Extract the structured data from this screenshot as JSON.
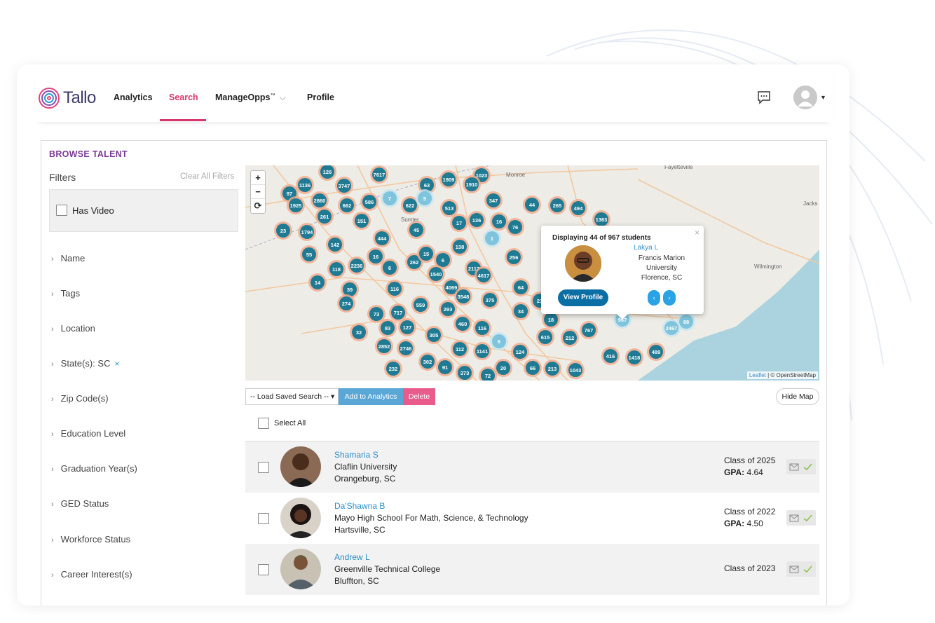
{
  "app": {
    "logo_text": "Tallo"
  },
  "nav": {
    "items": [
      {
        "label": "Analytics"
      },
      {
        "label": "Search"
      },
      {
        "label": "ManageOpps"
      },
      {
        "label": "Profile"
      }
    ],
    "trademark": "™",
    "active": "Search"
  },
  "browse": {
    "title": "BROWSE TALENT",
    "filters_label": "Filters",
    "clear_all": "Clear All Filters",
    "has_video": "Has Video",
    "filters": [
      {
        "label": "Name"
      },
      {
        "label": "Tags"
      },
      {
        "label": "Location"
      },
      {
        "label": "State(s): SC"
      },
      {
        "label": "Zip Code(s)"
      },
      {
        "label": "Education Level"
      },
      {
        "label": "Graduation Year(s)"
      },
      {
        "label": "GED Status"
      },
      {
        "label": "Workforce Status"
      },
      {
        "label": "Career Interest(s)"
      }
    ]
  },
  "map": {
    "zoom_in": "+",
    "zoom_out": "−",
    "reset": "⟳",
    "attribution_leaflet": "Leaflet",
    "attribution_rest": " | © OpenStreetMap",
    "place_labels": [
      "Monroe",
      "Fayetteville",
      "Wilmington",
      "Sumter",
      "Jacks"
    ],
    "clusters": [
      "126",
      "7617",
      "1136",
      "3747",
      "97",
      "2860",
      "1925",
      "662",
      "586",
      "622",
      "513",
      "1909",
      "63",
      "1023",
      "1910",
      "347",
      "44",
      "265",
      "494",
      "1363",
      "261",
      "151",
      "23",
      "1794",
      "45",
      "17",
      "136",
      "16",
      "76",
      "444",
      "142",
      "55",
      "16",
      "6",
      "262",
      "15",
      "6",
      "138",
      "256",
      "118",
      "2236",
      "1540",
      "2117",
      "4617",
      "14",
      "39",
      "116",
      "4069",
      "3548",
      "375",
      "64",
      "274",
      "559",
      "293",
      "21",
      "73",
      "717",
      "34",
      "18",
      "83",
      "127",
      "460",
      "116",
      "32",
      "305",
      "615",
      "212",
      "767",
      "2852",
      "2746",
      "112",
      "1141",
      "6",
      "124",
      "416",
      "1418",
      "489",
      "232",
      "302",
      "91",
      "373",
      "20",
      "66",
      "213",
      "1043",
      "72",
      "88",
      "2467",
      "967",
      "7",
      "5",
      "1"
    ],
    "popup": {
      "header": "Displaying 44 of 967 students",
      "name": "Lakya L",
      "school": "Francis Marion University",
      "location": "Florence, SC",
      "view_profile": "View Profile",
      "prev": "‹",
      "next": "›",
      "close": "×"
    }
  },
  "toolbar": {
    "load_saved": "-- Load Saved Search --",
    "add_analytics": "Add to Analytics",
    "delete": "Delete",
    "hide_map": "Hide Map",
    "select_all": "Select All"
  },
  "results": [
    {
      "name": "Shamaria S",
      "school": "Claflin University",
      "location": "Orangeburg, SC",
      "class": "Class of 2025",
      "gpa_label": "GPA:",
      "gpa": " 4.64"
    },
    {
      "name": "Da'Shawna B",
      "school": "Mayo High School For Math, Science, & Technology",
      "location": "Hartsville, SC",
      "class": "Class of 2022",
      "gpa_label": "GPA:",
      "gpa": " 4.50"
    },
    {
      "name": "Andrew L",
      "school": "Greenville Technical College",
      "location": "Bluffton, SC",
      "class": "Class of 2023",
      "gpa_label": "",
      "gpa": ""
    }
  ],
  "colors": {
    "accent_pink": "#d6376b",
    "brand_purple": "#7a3a94",
    "link_blue": "#2a8fc8",
    "cluster_dark": "#1f7a93",
    "cluster_light": "#7fc4dc",
    "cluster_ring": "#f0a98a"
  }
}
